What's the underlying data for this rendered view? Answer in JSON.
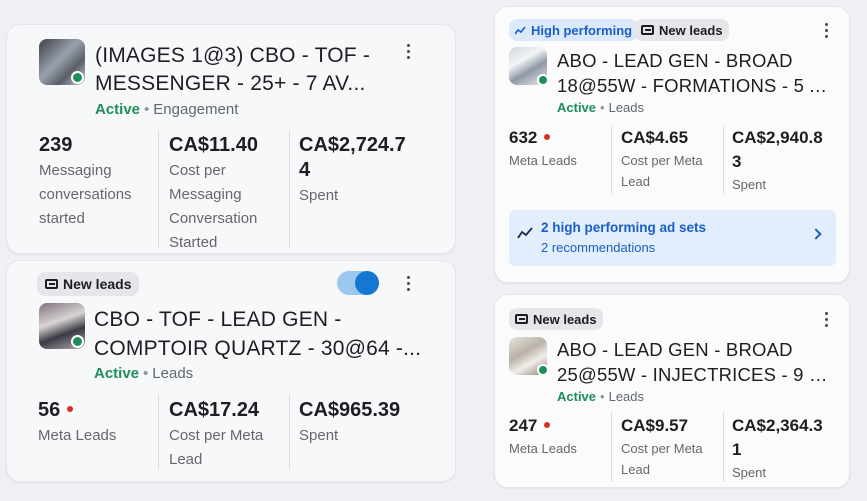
{
  "cards": [
    {
      "title": "(IMAGES 1@3) CBO - TOF - MESSENGER - 25+ - 7 AV...",
      "title_line1": "(IMAGES 1@3) CBO - TOF -",
      "title_line2": "MESSENGER - 25+ - 7 AV...",
      "status": "Active",
      "objective": "Engagement",
      "metrics": [
        {
          "value": "239",
          "label_lines": [
            "Messaging",
            "conversations",
            "started"
          ]
        },
        {
          "value": "CA$11.40",
          "label_lines": [
            "Cost per",
            "Messaging",
            "Conversation",
            "Started"
          ]
        },
        {
          "value_lines": [
            "CA$2,724.7",
            "4"
          ],
          "label_lines": [
            "Spent"
          ]
        }
      ]
    },
    {
      "badge": "New leads",
      "title_line1": "CBO - TOF - LEAD GEN -",
      "title_line2": "COMPTOIR QUARTZ - 30@64 -...",
      "status": "Active",
      "objective": "Leads",
      "toggle_on": true,
      "metrics": [
        {
          "value": "56",
          "label_lines": [
            "Meta Leads"
          ]
        },
        {
          "value": "CA$17.24",
          "label_lines": [
            "Cost per Meta",
            "Lead"
          ]
        },
        {
          "value": "CA$965.39",
          "label_lines": [
            "Spent"
          ]
        }
      ]
    },
    {
      "badge_hp": "High performing",
      "badge": "New leads",
      "title_line1": "ABO - LEAD GEN - BROAD",
      "title_line2": "18@55W - FORMATIONS - 5 A...",
      "status": "Active",
      "objective": "Leads",
      "metrics": [
        {
          "value": "632",
          "label_lines": [
            "Meta Leads"
          ]
        },
        {
          "value": "CA$4.65",
          "label_lines": [
            "Cost per Meta",
            "Lead"
          ]
        },
        {
          "value_lines": [
            "CA$2,940.8",
            "3"
          ],
          "label_lines": [
            "Spent"
          ]
        }
      ],
      "recommendation": {
        "title": "2 high performing ad sets",
        "subtitle": "2 recommendations"
      }
    },
    {
      "badge": "New leads",
      "title_line1": "ABO - LEAD GEN - BROAD",
      "title_line2": "25@55W - INJECTRICES - 9 M...",
      "status": "Active",
      "objective": "Leads",
      "metrics": [
        {
          "value": "247",
          "label_lines": [
            "Meta Leads"
          ]
        },
        {
          "value": "CA$9.57",
          "label_lines": [
            "Cost per Meta",
            "Lead"
          ]
        },
        {
          "value_lines": [
            "CA$2,364.3",
            "1"
          ],
          "label_lines": [
            "Spent"
          ]
        }
      ]
    }
  ],
  "colors": {
    "active": "#1e8e5a",
    "accent": "#1577d4",
    "red_dot": "#d6311f"
  },
  "icons": [
    "more-vertical-icon",
    "lead-form-icon",
    "trend-line-icon",
    "chevron-right-icon",
    "status-dot-icon"
  ]
}
